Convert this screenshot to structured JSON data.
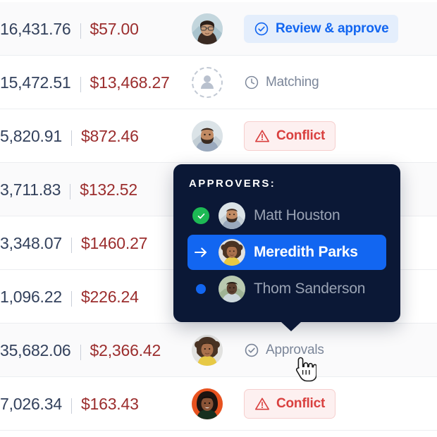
{
  "colors": {
    "accent_blue": "#1266f1",
    "pill_blue_bg": "#e4eefc",
    "danger_red": "#d9403f",
    "danger_bg": "#fdf0f0",
    "amount_primary": "#33415c",
    "amount_secondary": "#9b2d2d",
    "tooltip_bg": "#0b1836",
    "muted_text": "#7b8699",
    "check_green": "#1db954",
    "row_alt_bg": "#fafafb"
  },
  "table": {
    "rows": [
      {
        "amount_primary": "16,431.76",
        "amount_secondary": "$57.00",
        "avatar": "avatar-woman-glasses",
        "avatar_kind": "photo",
        "status_label": "Review & approve",
        "status_style": "primary",
        "status_icon": "check-circle-icon",
        "alt_background": true
      },
      {
        "amount_primary": "15,472.51",
        "amount_secondary": "$13,468.27",
        "avatar": "avatar-placeholder",
        "avatar_kind": "empty",
        "status_label": "Matching",
        "status_style": "plain",
        "status_icon": "clock-icon",
        "alt_background": false
      },
      {
        "amount_primary": "5,820.91",
        "amount_secondary": "$872.46",
        "avatar": "avatar-bearded-man",
        "avatar_kind": "photo",
        "status_label": "Conflict",
        "status_style": "danger",
        "status_icon": "warning-triangle-icon",
        "alt_background": false
      },
      {
        "amount_primary": "3,711.83",
        "amount_secondary": "$132.52",
        "avatar": "",
        "avatar_kind": "none",
        "status_label": "",
        "status_style": "none",
        "status_icon": "",
        "alt_background": true
      },
      {
        "amount_primary": "3,348.07",
        "amount_secondary": "$1460.27",
        "avatar": "",
        "avatar_kind": "none",
        "status_label": "",
        "status_style": "none",
        "status_icon": "",
        "alt_background": false
      },
      {
        "amount_primary": "1,096.22",
        "amount_secondary": "$226.24",
        "avatar": "",
        "avatar_kind": "none",
        "status_label": "",
        "status_style": "none",
        "status_icon": "",
        "alt_background": false
      },
      {
        "amount_primary": "35,682.06",
        "amount_secondary": "$2,366.42",
        "avatar": "avatar-curly-woman",
        "avatar_kind": "photo",
        "status_label": "Approvals",
        "status_style": "plain",
        "status_icon": "check-circle-icon",
        "alt_background": true
      },
      {
        "amount_primary": "7,026.34",
        "amount_secondary": "$163.43",
        "avatar": "avatar-smiling-woman",
        "avatar_kind": "photo",
        "status_label": "Conflict",
        "status_style": "danger",
        "status_icon": "warning-triangle-icon",
        "alt_background": false
      }
    ]
  },
  "tooltip": {
    "title": "APPROVERS:",
    "approvers": [
      {
        "name": "Matt Houston",
        "marker": "check-icon",
        "state": "approved",
        "avatar": "avatar-bearded-man"
      },
      {
        "name": "Meredith Parks",
        "marker": "arrow-right-icon",
        "state": "current",
        "avatar": "avatar-curly-woman"
      },
      {
        "name": "Thom Sanderson",
        "marker": "dot-icon",
        "state": "pending",
        "avatar": "avatar-man-cap"
      }
    ]
  },
  "cursor": {
    "icon": "pointing-hand-cursor"
  }
}
